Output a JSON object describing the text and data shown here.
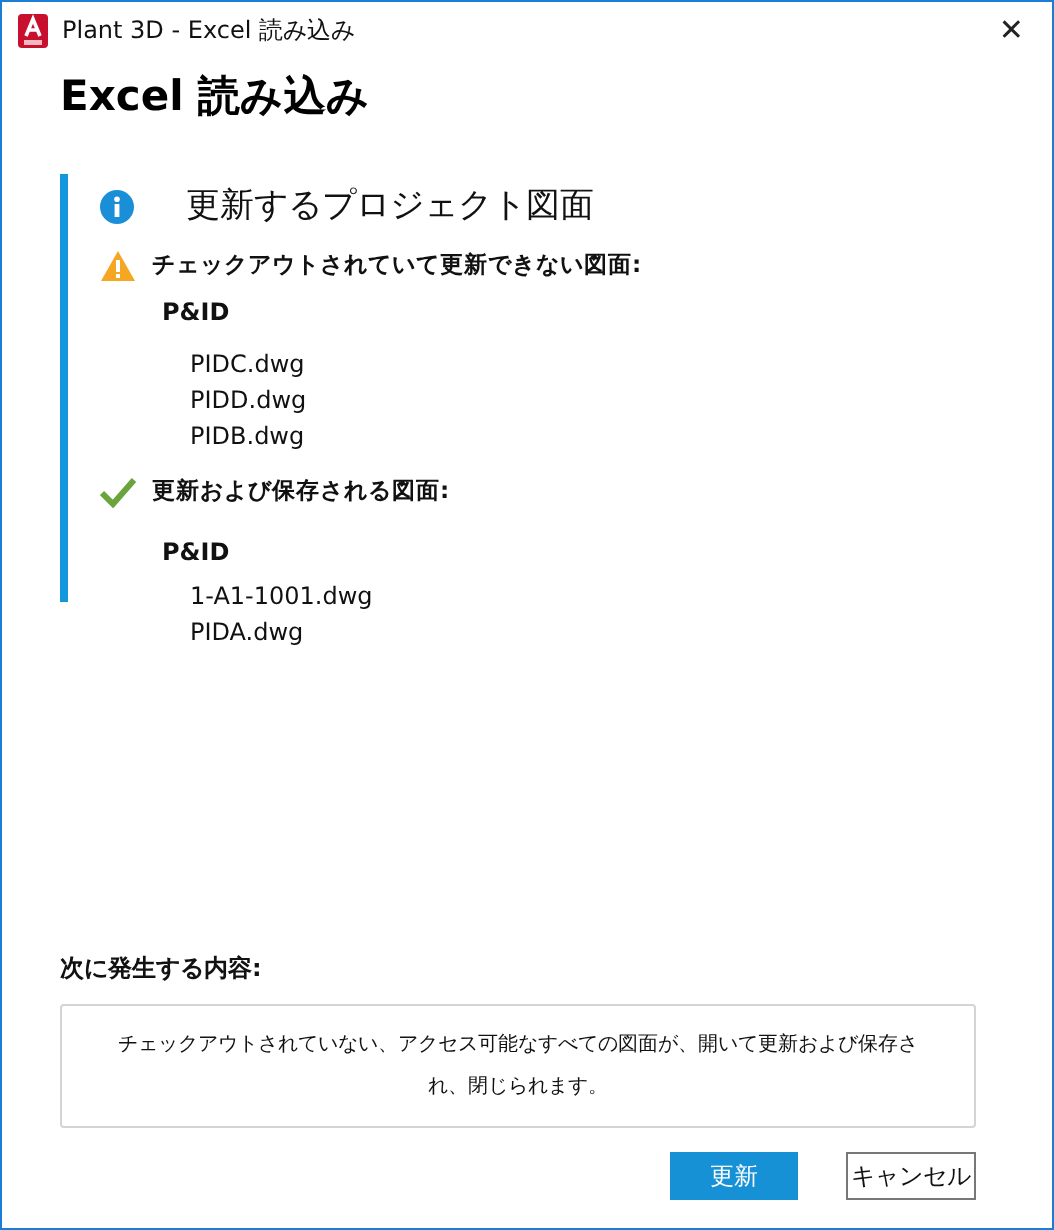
{
  "window": {
    "title": "Plant 3D - Excel 読み込み",
    "close": "✕"
  },
  "heading": "Excel 読み込み",
  "section": {
    "title": "更新するプロジェクト図面",
    "groups": [
      {
        "kind": "warning",
        "label": "チェックアウトされていて更新できない図面:",
        "categories": [
          {
            "name": "P&ID",
            "files": [
              "PIDC.dwg",
              "PIDD.dwg",
              "PIDB.dwg"
            ]
          }
        ]
      },
      {
        "kind": "success",
        "label": "更新および保存される図面:",
        "categories": [
          {
            "name": "P&ID",
            "files": [
              "1-A1-1001.dwg",
              "PIDA.dwg"
            ]
          }
        ]
      }
    ]
  },
  "next": {
    "label": "次に発生する内容:",
    "text": "チェックアウトされていない、アクセス可能なすべての図面が、開いて更新および保存され、閉じられます。"
  },
  "buttons": [
    {
      "label": "更新",
      "kind": "primary"
    },
    {
      "label": "キャンセル",
      "kind": "secondary"
    }
  ]
}
